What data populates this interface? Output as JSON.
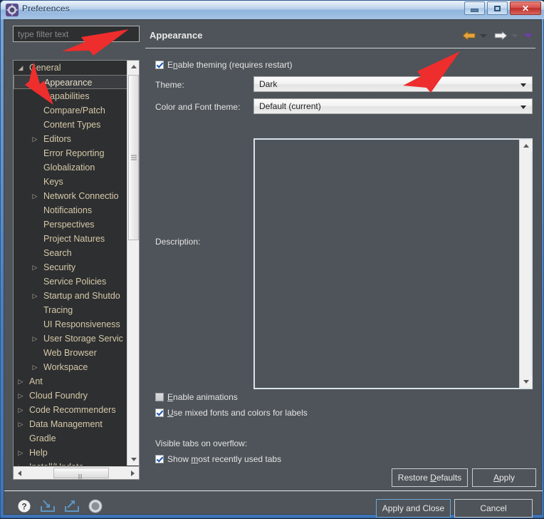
{
  "window": {
    "title": "Preferences",
    "icon": "preferences-gear-icon",
    "minimize_label": "Minimize",
    "maximize_label": "Maximize",
    "close_label": "Close"
  },
  "sidebar": {
    "filter_placeholder": "type filter text",
    "filter_value": "",
    "items": [
      {
        "label": "General",
        "level": 0,
        "twisty": "expanded",
        "selected": false
      },
      {
        "label": "Appearance",
        "level": 1,
        "twisty": "collapsed",
        "selected": true
      },
      {
        "label": "Capabilities",
        "level": 1,
        "twisty": "none",
        "selected": false
      },
      {
        "label": "Compare/Patch",
        "level": 1,
        "twisty": "none",
        "selected": false
      },
      {
        "label": "Content Types",
        "level": 1,
        "twisty": "none",
        "selected": false
      },
      {
        "label": "Editors",
        "level": 1,
        "twisty": "collapsed",
        "selected": false
      },
      {
        "label": "Error Reporting",
        "level": 1,
        "twisty": "none",
        "selected": false
      },
      {
        "label": "Globalization",
        "level": 1,
        "twisty": "none",
        "selected": false
      },
      {
        "label": "Keys",
        "level": 1,
        "twisty": "none",
        "selected": false
      },
      {
        "label": "Network Connectio",
        "level": 1,
        "twisty": "collapsed",
        "selected": false
      },
      {
        "label": "Notifications",
        "level": 1,
        "twisty": "none",
        "selected": false
      },
      {
        "label": "Perspectives",
        "level": 1,
        "twisty": "none",
        "selected": false
      },
      {
        "label": "Project Natures",
        "level": 1,
        "twisty": "none",
        "selected": false
      },
      {
        "label": "Search",
        "level": 1,
        "twisty": "none",
        "selected": false
      },
      {
        "label": "Security",
        "level": 1,
        "twisty": "collapsed",
        "selected": false
      },
      {
        "label": "Service Policies",
        "level": 1,
        "twisty": "none",
        "selected": false
      },
      {
        "label": "Startup and Shutdo",
        "level": 1,
        "twisty": "collapsed",
        "selected": false
      },
      {
        "label": "Tracing",
        "level": 1,
        "twisty": "none",
        "selected": false
      },
      {
        "label": "UI Responsiveness",
        "level": 1,
        "twisty": "none",
        "selected": false
      },
      {
        "label": "User Storage Servic",
        "level": 1,
        "twisty": "collapsed",
        "selected": false
      },
      {
        "label": "Web Browser",
        "level": 1,
        "twisty": "none",
        "selected": false
      },
      {
        "label": "Workspace",
        "level": 1,
        "twisty": "collapsed",
        "selected": false
      },
      {
        "label": "Ant",
        "level": 0,
        "twisty": "collapsed",
        "selected": false
      },
      {
        "label": "Cloud Foundry",
        "level": 0,
        "twisty": "collapsed",
        "selected": false
      },
      {
        "label": "Code Recommenders",
        "level": 0,
        "twisty": "collapsed",
        "selected": false
      },
      {
        "label": "Data Management",
        "level": 0,
        "twisty": "collapsed",
        "selected": false
      },
      {
        "label": "Gradle",
        "level": 0,
        "twisty": "none",
        "selected": false
      },
      {
        "label": "Help",
        "level": 0,
        "twisty": "collapsed",
        "selected": false
      },
      {
        "label": "Install/Update",
        "level": 0,
        "twisty": "collapsed",
        "selected": false
      }
    ]
  },
  "content": {
    "title": "Appearance",
    "nav": {
      "back_icon": "arrow-left-icon",
      "back_menu_icon": "chevron-down-icon",
      "forward_icon": "arrow-right-icon",
      "forward_menu_icon": "chevron-down-icon",
      "view_menu_icon": "chevron-down-icon"
    },
    "enable_theming": {
      "label_pre": "E",
      "label_mnemonic": "n",
      "label_post": "able theming (requires restart)",
      "checked": true
    },
    "theme": {
      "label": "Theme:",
      "value": "Dark",
      "options": [
        "Dark"
      ]
    },
    "color_font_theme": {
      "label": "Color and Font theme:",
      "value": "Default (current)",
      "options": [
        "Default (current)"
      ]
    },
    "description": {
      "label": "Description:",
      "text": ""
    },
    "enable_animations": {
      "label_pre": "",
      "label_mnemonic": "E",
      "label_post": "nable animations",
      "checked": false
    },
    "mixed_fonts": {
      "label_pre": "",
      "label_mnemonic": "U",
      "label_post": "se mixed fonts and colors for labels",
      "checked": true
    },
    "visible_tabs_label": "Visible tabs on overflow:",
    "show_mru_tabs": {
      "label_pre": "Show ",
      "label_mnemonic": "m",
      "label_post": "ost recently used tabs",
      "checked": true
    },
    "restore_defaults": {
      "label_pre": "Restore ",
      "label_mnemonic": "D",
      "label_post": "efaults"
    },
    "apply": {
      "label_pre": "",
      "label_mnemonic": "A",
      "label_post": "pply"
    }
  },
  "footer": {
    "icons": [
      {
        "name": "help-icon",
        "glyph": "?"
      },
      {
        "name": "import-icon",
        "glyph": "import"
      },
      {
        "name": "export-icon",
        "glyph": "export"
      },
      {
        "name": "settings-icon",
        "glyph": "gear"
      }
    ],
    "apply_and_close": "Apply and Close",
    "cancel": "Cancel"
  },
  "annotations": {
    "color": "#ee2d2d",
    "arrows": [
      {
        "name": "arrow-to-general-tree-item"
      },
      {
        "name": "arrow-to-appearance-tree-item"
      },
      {
        "name": "arrow-to-theme-combo"
      }
    ]
  },
  "colors": {
    "window_chrome": "#4a7fc0",
    "panel_bg": "#4e5459",
    "tree_bg": "#2d2f31",
    "tree_text": "#d7c9a8",
    "content_text": "#e4e4e4",
    "combo_bg": "#f2f2f2",
    "annotation_red": "#ee2d2d",
    "nav_back": "#e8a33d",
    "nav_forward": "#f2f2f2",
    "nav_menu_purple": "#6b3fa0"
  }
}
